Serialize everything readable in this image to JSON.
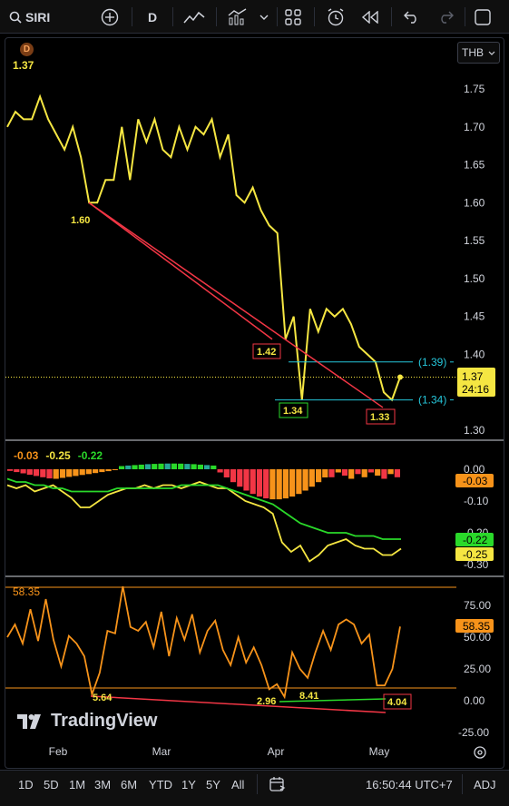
{
  "toolbar": {
    "symbol": "SIRI",
    "interval": "D"
  },
  "chart": {
    "currency": "THB",
    "badge": "D",
    "last_value": "1.37",
    "price_axis": [
      "1.75",
      "1.70",
      "1.65",
      "1.60",
      "1.55",
      "1.50",
      "1.45",
      "1.40",
      "1.35",
      "1.30"
    ],
    "price_label_value": "1.37",
    "price_label_countdown": "24:16",
    "annotations": {
      "a160": "1.60",
      "a142": "1.42",
      "a134": "1.34",
      "a133": "1.33",
      "level139": "(1.39)",
      "level134": "(1.34)"
    }
  },
  "macd": {
    "legend": [
      "-0.03",
      "-0.25",
      "-0.22"
    ],
    "axis": [
      "0.00",
      "-0.10",
      "-0.20",
      "-0.30"
    ],
    "labels": [
      "-0.03",
      "-0.22",
      "-0.25"
    ]
  },
  "rsi": {
    "top_label": "58.35",
    "axis": [
      "75.00",
      "50.00",
      "25.00",
      "0.00",
      "-25.00"
    ],
    "label": "58.35",
    "annotations": {
      "r564": "5.64",
      "r296": "2.96",
      "r841": "8.41",
      "r404": "4.04"
    }
  },
  "time_axis": [
    "Feb",
    "Mar",
    "Apr",
    "May"
  ],
  "branding": "TradingView",
  "bottom": {
    "ranges": [
      "1D",
      "5D",
      "1M",
      "3M",
      "6M",
      "YTD",
      "1Y",
      "5Y",
      "All"
    ],
    "clock": "16:50:44 UTC+7",
    "adj": "ADJ"
  },
  "colors": {
    "price_line": "#f5e642",
    "trend_red": "#f23645",
    "level_teal": "#26c6da",
    "rsi_line": "#f7931a",
    "signal_green": "#2ad92a"
  },
  "series": {
    "price": [
      1.7,
      1.72,
      1.71,
      1.71,
      1.74,
      1.71,
      1.69,
      1.67,
      1.7,
      1.66,
      1.6,
      1.6,
      1.63,
      1.63,
      1.7,
      1.63,
      1.71,
      1.68,
      1.71,
      1.67,
      1.66,
      1.7,
      1.67,
      1.7,
      1.69,
      1.71,
      1.66,
      1.69,
      1.61,
      1.6,
      1.62,
      1.59,
      1.57,
      1.56,
      1.42,
      1.45,
      1.34,
      1.46,
      1.43,
      1.46,
      1.45,
      1.46,
      1.44,
      1.41,
      1.4,
      1.39,
      1.35,
      1.34,
      1.37
    ],
    "rsi": [
      50,
      60,
      45,
      72,
      47,
      80,
      48,
      27,
      51,
      45,
      35,
      5,
      22,
      55,
      53,
      90,
      58,
      55,
      62,
      42,
      70,
      35,
      65,
      48,
      68,
      38,
      55,
      63,
      40,
      28,
      50,
      30,
      42,
      28,
      9,
      13,
      3,
      38,
      25,
      18,
      38,
      55,
      40,
      60,
      64,
      60,
      45,
      52,
      12,
      12,
      25,
      58.35
    ]
  }
}
